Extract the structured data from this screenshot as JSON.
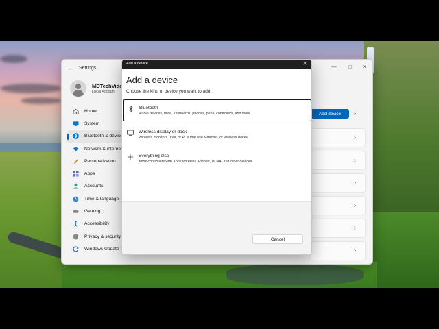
{
  "settings_window": {
    "title": "Settings",
    "user": {
      "name": "MDTechVideos",
      "account_type": "Local Account"
    },
    "nav": [
      {
        "label": "Home",
        "icon": "home-icon",
        "color": "#5a5a5a"
      },
      {
        "label": "System",
        "icon": "system-icon",
        "color": "#0078d4"
      },
      {
        "label": "Bluetooth & devices",
        "icon": "bluetooth-icon",
        "color": "#0078d4"
      },
      {
        "label": "Network & internet",
        "icon": "network-icon",
        "color": "#1a73c8"
      },
      {
        "label": "Personalization",
        "icon": "personalization-icon",
        "color": "#e08a2b"
      },
      {
        "label": "Apps",
        "icon": "apps-icon",
        "color": "#5a6ac9"
      },
      {
        "label": "Accounts",
        "icon": "accounts-icon",
        "color": "#2aa1a1"
      },
      {
        "label": "Time & language",
        "icon": "time-language-icon",
        "color": "#2f86d6"
      },
      {
        "label": "Gaming",
        "icon": "gaming-icon",
        "color": "#8a8a8a"
      },
      {
        "label": "Accessibility",
        "icon": "accessibility-icon",
        "color": "#1d6fc2"
      },
      {
        "label": "Privacy & security",
        "icon": "privacy-icon",
        "color": "#8a8a8a"
      },
      {
        "label": "Windows Update",
        "icon": "windows-update-icon",
        "color": "#1d6fc2"
      }
    ],
    "add_device_button": "Add device",
    "peek_text": "s"
  },
  "dialog": {
    "title_bar": "Add a device",
    "heading": "Add a device",
    "subtitle": "Choose the kind of device you want to add.",
    "options": [
      {
        "title": "Bluetooth",
        "description": "Audio devices, mice, keyboards, phones, pens, controllers, and more",
        "icon": "bluetooth-icon"
      },
      {
        "title": "Wireless display or dock",
        "description": "Wireless monitors, TVs, or PCs that use Miracast, or wireless docks",
        "icon": "monitor-icon"
      },
      {
        "title": "Everything else",
        "description": "Xbox controllers with Xbox Wireless Adapter, DLNA, and other devices",
        "icon": "plus-icon"
      }
    ],
    "cancel_label": "Cancel"
  },
  "accent_color": "#0067c0"
}
